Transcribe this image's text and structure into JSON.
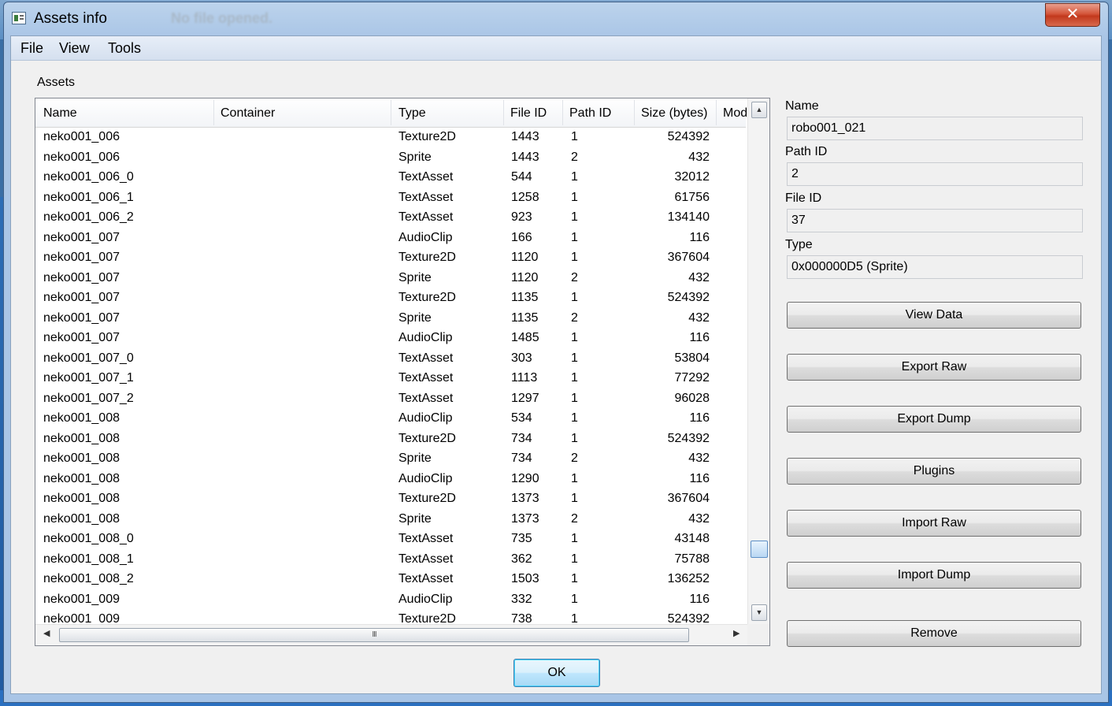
{
  "window": {
    "title": "Assets info",
    "background_title": "No file opened.",
    "close_glyph": "✕"
  },
  "menu": [
    "File",
    "View",
    "Tools"
  ],
  "assets_group_label": "Assets",
  "table": {
    "columns": [
      "Name",
      "Container",
      "Type",
      "File ID",
      "Path ID",
      "Size (bytes)",
      "Mod"
    ],
    "rows": [
      [
        "neko001_006",
        "",
        "Texture2D",
        "1443",
        "1",
        "524392"
      ],
      [
        "neko001_006",
        "",
        "Sprite",
        "1443",
        "2",
        "432"
      ],
      [
        "neko001_006_0",
        "",
        "TextAsset",
        "544",
        "1",
        "32012"
      ],
      [
        "neko001_006_1",
        "",
        "TextAsset",
        "1258",
        "1",
        "61756"
      ],
      [
        "neko001_006_2",
        "",
        "TextAsset",
        "923",
        "1",
        "134140"
      ],
      [
        "neko001_007",
        "",
        "AudioClip",
        "166",
        "1",
        "116"
      ],
      [
        "neko001_007",
        "",
        "Texture2D",
        "1120",
        "1",
        "367604"
      ],
      [
        "neko001_007",
        "",
        "Sprite",
        "1120",
        "2",
        "432"
      ],
      [
        "neko001_007",
        "",
        "Texture2D",
        "1135",
        "1",
        "524392"
      ],
      [
        "neko001_007",
        "",
        "Sprite",
        "1135",
        "2",
        "432"
      ],
      [
        "neko001_007",
        "",
        "AudioClip",
        "1485",
        "1",
        "116"
      ],
      [
        "neko001_007_0",
        "",
        "TextAsset",
        "303",
        "1",
        "53804"
      ],
      [
        "neko001_007_1",
        "",
        "TextAsset",
        "1113",
        "1",
        "77292"
      ],
      [
        "neko001_007_2",
        "",
        "TextAsset",
        "1297",
        "1",
        "96028"
      ],
      [
        "neko001_008",
        "",
        "AudioClip",
        "534",
        "1",
        "116"
      ],
      [
        "neko001_008",
        "",
        "Texture2D",
        "734",
        "1",
        "524392"
      ],
      [
        "neko001_008",
        "",
        "Sprite",
        "734",
        "2",
        "432"
      ],
      [
        "neko001_008",
        "",
        "AudioClip",
        "1290",
        "1",
        "116"
      ],
      [
        "neko001_008",
        "",
        "Texture2D",
        "1373",
        "1",
        "367604"
      ],
      [
        "neko001_008",
        "",
        "Sprite",
        "1373",
        "2",
        "432"
      ],
      [
        "neko001_008_0",
        "",
        "TextAsset",
        "735",
        "1",
        "43148"
      ],
      [
        "neko001_008_1",
        "",
        "TextAsset",
        "362",
        "1",
        "75788"
      ],
      [
        "neko001_008_2",
        "",
        "TextAsset",
        "1503",
        "1",
        "136252"
      ],
      [
        "neko001_009",
        "",
        "AudioClip",
        "332",
        "1",
        "116"
      ],
      [
        "neko001_009",
        "",
        "Texture2D",
        "738",
        "1",
        "524392"
      ]
    ],
    "scroll_up_glyph": "▲",
    "scroll_down_glyph": "▼",
    "scroll_left_glyph": "◀",
    "scroll_right_glyph": "▶",
    "hscroll_grip": "III"
  },
  "properties": {
    "name_label": "Name",
    "name_value": "robo001_021",
    "path_id_label": "Path ID",
    "path_id_value": "2",
    "file_id_label": "File ID",
    "file_id_value": "37",
    "type_label": "Type",
    "type_value": "0x000000D5 (Sprite)"
  },
  "buttons": {
    "view_data": "View Data",
    "export_raw": "Export Raw",
    "export_dump": "Export Dump",
    "plugins": "Plugins",
    "import_raw": "Import Raw",
    "import_dump": "Import Dump",
    "remove": "Remove",
    "ok": "OK"
  },
  "colors": {
    "title_bar": "#a9c5e6",
    "close_button": "#c2391d",
    "ok_button_border": "#3c7fb1",
    "scroll_thumb": "#b9d7f3"
  },
  "icons": {
    "window_icon": "window-app-icon"
  }
}
